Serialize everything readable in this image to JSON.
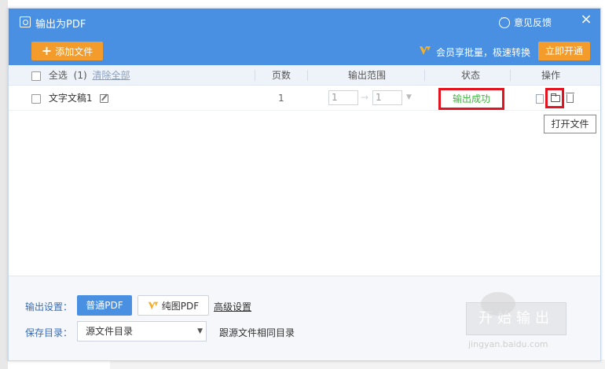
{
  "window": {
    "title": "输出为PDF",
    "feedback_label": "意见反馈",
    "close_glyph": "×"
  },
  "toolbar": {
    "add_file_label": "添加文件",
    "vip_promo_text": "会员享批量，极速转换",
    "open_vip_label": "立即开通"
  },
  "table": {
    "select_all_label": "全选",
    "select_count": "(1)",
    "clear_all_label": "清除全部",
    "headers": {
      "pages": "页数",
      "range": "输出范围",
      "status": "状态",
      "actions": "操作"
    },
    "rows": [
      {
        "name": "文字文稿1",
        "pages": "1",
        "range_from": "1",
        "range_to": "1",
        "range_separator": "→",
        "status": "输出成功"
      }
    ],
    "tooltip": "打开文件"
  },
  "footer": {
    "output_settings_label": "输出设置：",
    "normal_pdf_label": "普通PDF",
    "image_pdf_label": "纯图PDF",
    "advanced_settings_label": "高级设置",
    "save_dir_label": "保存目录：",
    "save_dir_value": "源文件目录",
    "same_dir_text": "跟源文件相同目录",
    "start_button_label": "开始输出"
  },
  "watermark": {
    "text": "jingyan.baidu.com"
  },
  "colors": {
    "title_bar": "#4a90e2",
    "accent_orange": "#f39c2c",
    "success_green": "#3fb43f",
    "highlight_red": "#e3141f"
  },
  "icons": [
    "title-pdf-icon",
    "feedback-icon",
    "close-icon",
    "plus-icon",
    "vip-icon",
    "edit-icon",
    "file-icon",
    "folder-icon",
    "trash-icon",
    "dropdown-arrow-icon"
  ]
}
